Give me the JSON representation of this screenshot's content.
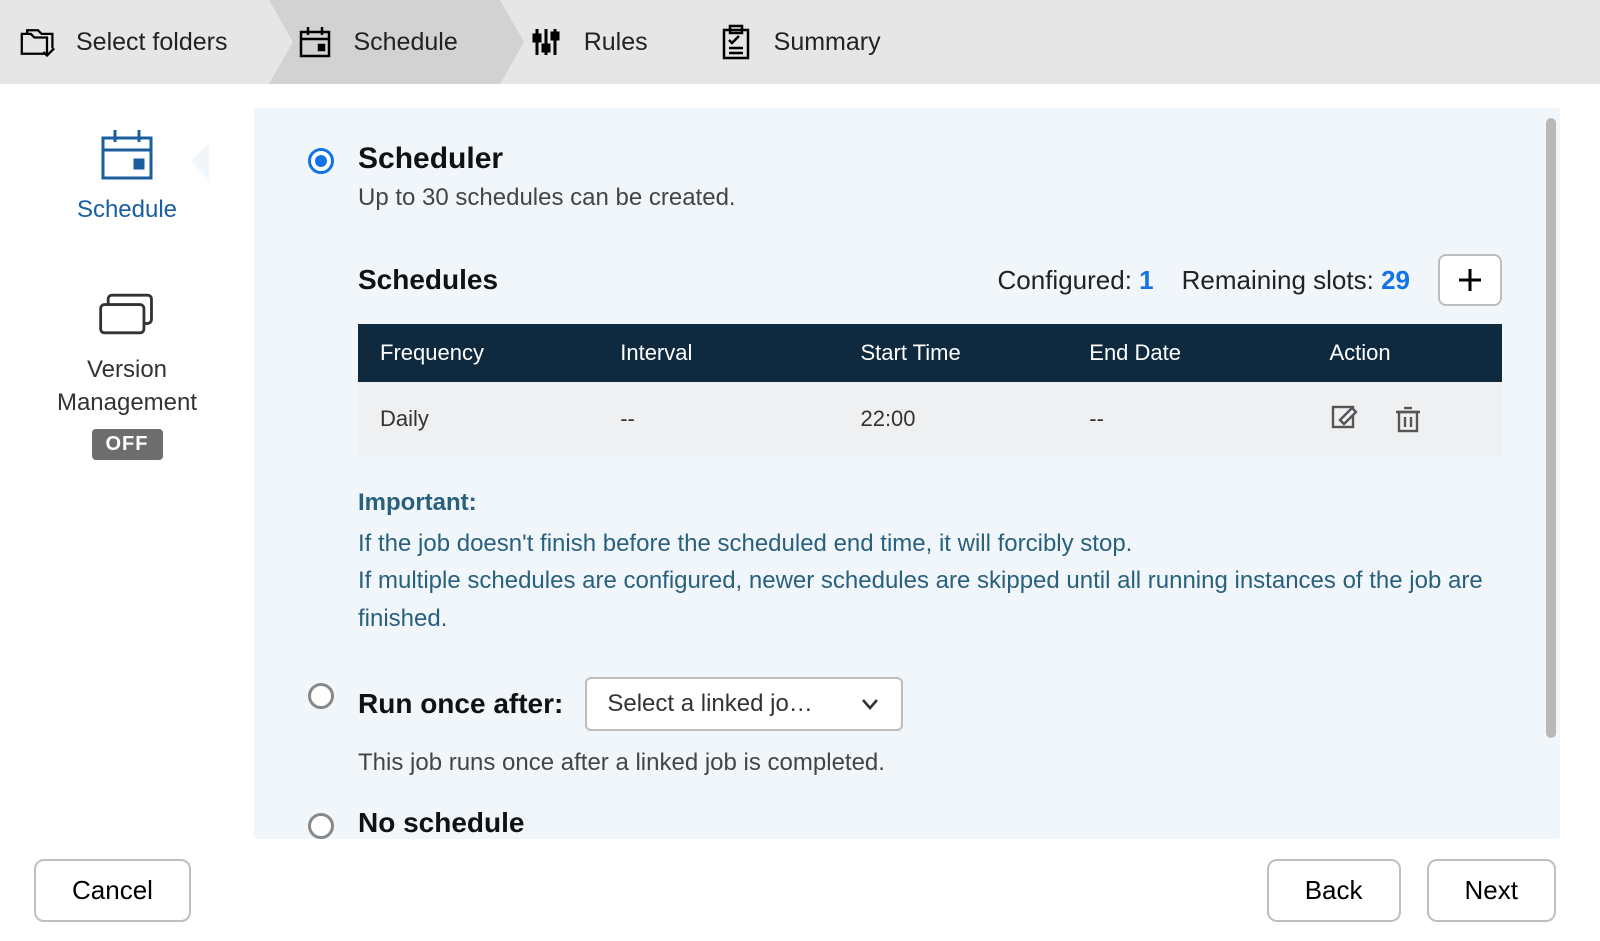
{
  "wizard": {
    "steps": [
      {
        "label": "Select folders"
      },
      {
        "label": "Schedule"
      },
      {
        "label": "Rules"
      },
      {
        "label": "Summary"
      }
    ],
    "active_index": 1
  },
  "sidebar": {
    "items": [
      {
        "label": "Schedule",
        "active": true
      },
      {
        "label": "Version\nManagement",
        "badge": "OFF",
        "active": false
      }
    ]
  },
  "scheduler": {
    "title": "Scheduler",
    "subtitle": "Up to 30 schedules can be created.",
    "schedules_heading": "Schedules",
    "configured_label": "Configured:",
    "configured_count": "1",
    "remaining_label": "Remaining slots:",
    "remaining_count": "29",
    "columns": [
      "Frequency",
      "Interval",
      "Start Time",
      "End Date",
      "Action"
    ],
    "rows": [
      {
        "frequency": "Daily",
        "interval": "--",
        "start_time": "22:00",
        "end_date": "--"
      }
    ],
    "important": {
      "title": "Important:",
      "line1": "If the job doesn't finish before the scheduled end time, it will forcibly stop.",
      "line2": "If multiple schedules are configured, newer schedules are skipped until all running instances of the job are finished."
    }
  },
  "run_once": {
    "title": "Run once after:",
    "select_placeholder": "Select a linked jo…",
    "description": "This job runs once after a linked job is completed."
  },
  "no_schedule": {
    "title": "No schedule"
  },
  "footer": {
    "cancel": "Cancel",
    "back": "Back",
    "next": "Next"
  }
}
